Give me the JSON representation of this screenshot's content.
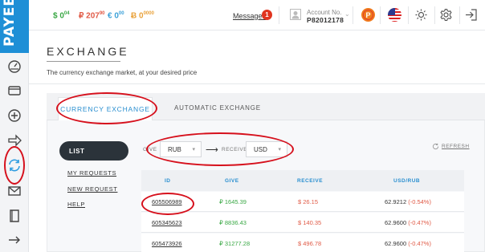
{
  "brand": {
    "logo_text": "PAYEE",
    "color": "#1e8fd6"
  },
  "rail": {
    "items": [
      {
        "name": "dashboard",
        "icon": "dashboard-icon"
      },
      {
        "name": "wallet",
        "icon": "wallet-icon"
      },
      {
        "name": "add-funds",
        "icon": "plus-circle-icon"
      },
      {
        "name": "transfer",
        "icon": "arrow-right-icon"
      },
      {
        "name": "exchange",
        "icon": "exchange-icon",
        "active": true
      },
      {
        "name": "messages",
        "icon": "envelope-icon"
      },
      {
        "name": "history",
        "icon": "book-icon"
      },
      {
        "name": "collapse",
        "icon": "arrow-right-long-icon"
      }
    ]
  },
  "balances": {
    "usd": {
      "symbol": "$",
      "main": "0",
      "cents": "04"
    },
    "rub": {
      "symbol": "₽",
      "main": "207",
      "cents": "90"
    },
    "eur": {
      "symbol": "€",
      "main": "0",
      "cents": "00"
    },
    "btc": {
      "symbol": "Ƀ",
      "main": "0",
      "cents": "0000"
    }
  },
  "header": {
    "messages_label": "Messages",
    "messages_count": "1",
    "account_label": "Account No.",
    "account_number": "P82012178"
  },
  "page": {
    "title": "EXCHANGE",
    "subtitle": "The currency exchange market, at your desired price"
  },
  "tabs": [
    {
      "label": "CURRENCY EXCHANGE",
      "active": true
    },
    {
      "label": "AUTOMATIC EXCHANGE",
      "active": false
    }
  ],
  "side_menu": {
    "list_label": "LIST",
    "links": [
      "MY REQUESTS",
      "NEW REQUEST",
      "HELP"
    ]
  },
  "filters": {
    "give_label": "GIVE",
    "give_value": "RUB",
    "receive_label": "RECEIVE",
    "receive_value": "USD",
    "refresh_label": "REFRESH"
  },
  "table": {
    "columns": [
      "ID",
      "GIVE",
      "RECEIVE",
      "USD/RUB"
    ],
    "rows": [
      {
        "id": "605506989",
        "give": "₽ 1645.39",
        "receive": "$ 26.15",
        "rate": "62.9212",
        "change": "(-0.54%)"
      },
      {
        "id": "605345623",
        "give": "₽ 8836.43",
        "receive": "$ 140.35",
        "rate": "62.9600",
        "change": "(-0.47%)"
      },
      {
        "id": "605473926",
        "give": "₽ 31277.28",
        "receive": "$ 496.78",
        "rate": "62.9600",
        "change": "(-0.47%)"
      }
    ]
  },
  "colors": {
    "accent": "#2a8fd0",
    "positive": "#3aa845",
    "negative": "#e05a46",
    "annotation": "#d6101c"
  }
}
